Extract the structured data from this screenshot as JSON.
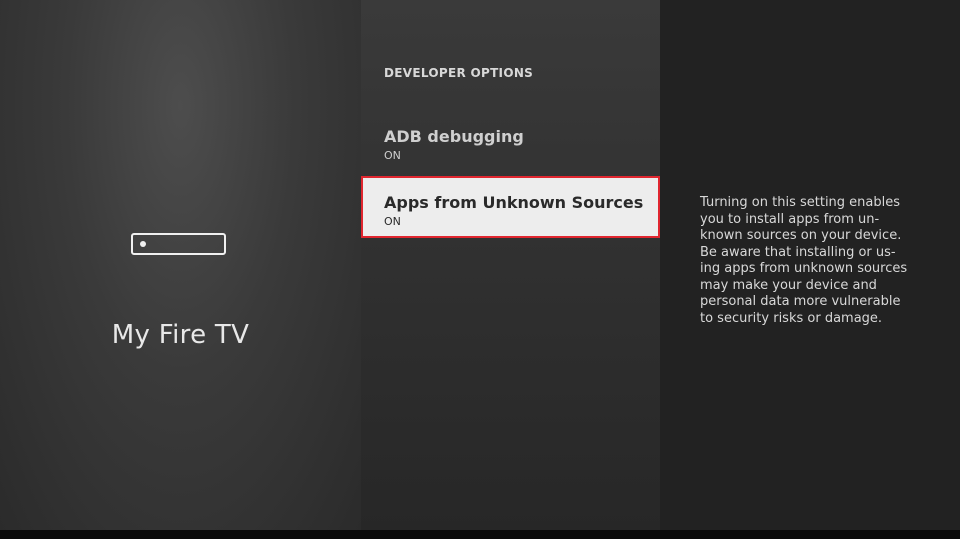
{
  "device": {
    "title": "My Fire TV",
    "icon": "fire-tv-device-icon"
  },
  "menu": {
    "header": "DEVELOPER OPTIONS",
    "items": [
      {
        "label": "ADB debugging",
        "value": "ON",
        "selected": false
      },
      {
        "label": "Apps from Unknown Sources",
        "value": "ON",
        "selected": true
      }
    ]
  },
  "description": {
    "text": "Turning on this setting enables you to install apps from un-known sources on your device. Be aware that installing or us-ing apps from unknown sources may make your device and personal data more vulnerable to security risks or damage."
  },
  "colors": {
    "selection_border": "#e0262f",
    "selected_background": "#ededed",
    "right_panel_background": "#222222"
  }
}
